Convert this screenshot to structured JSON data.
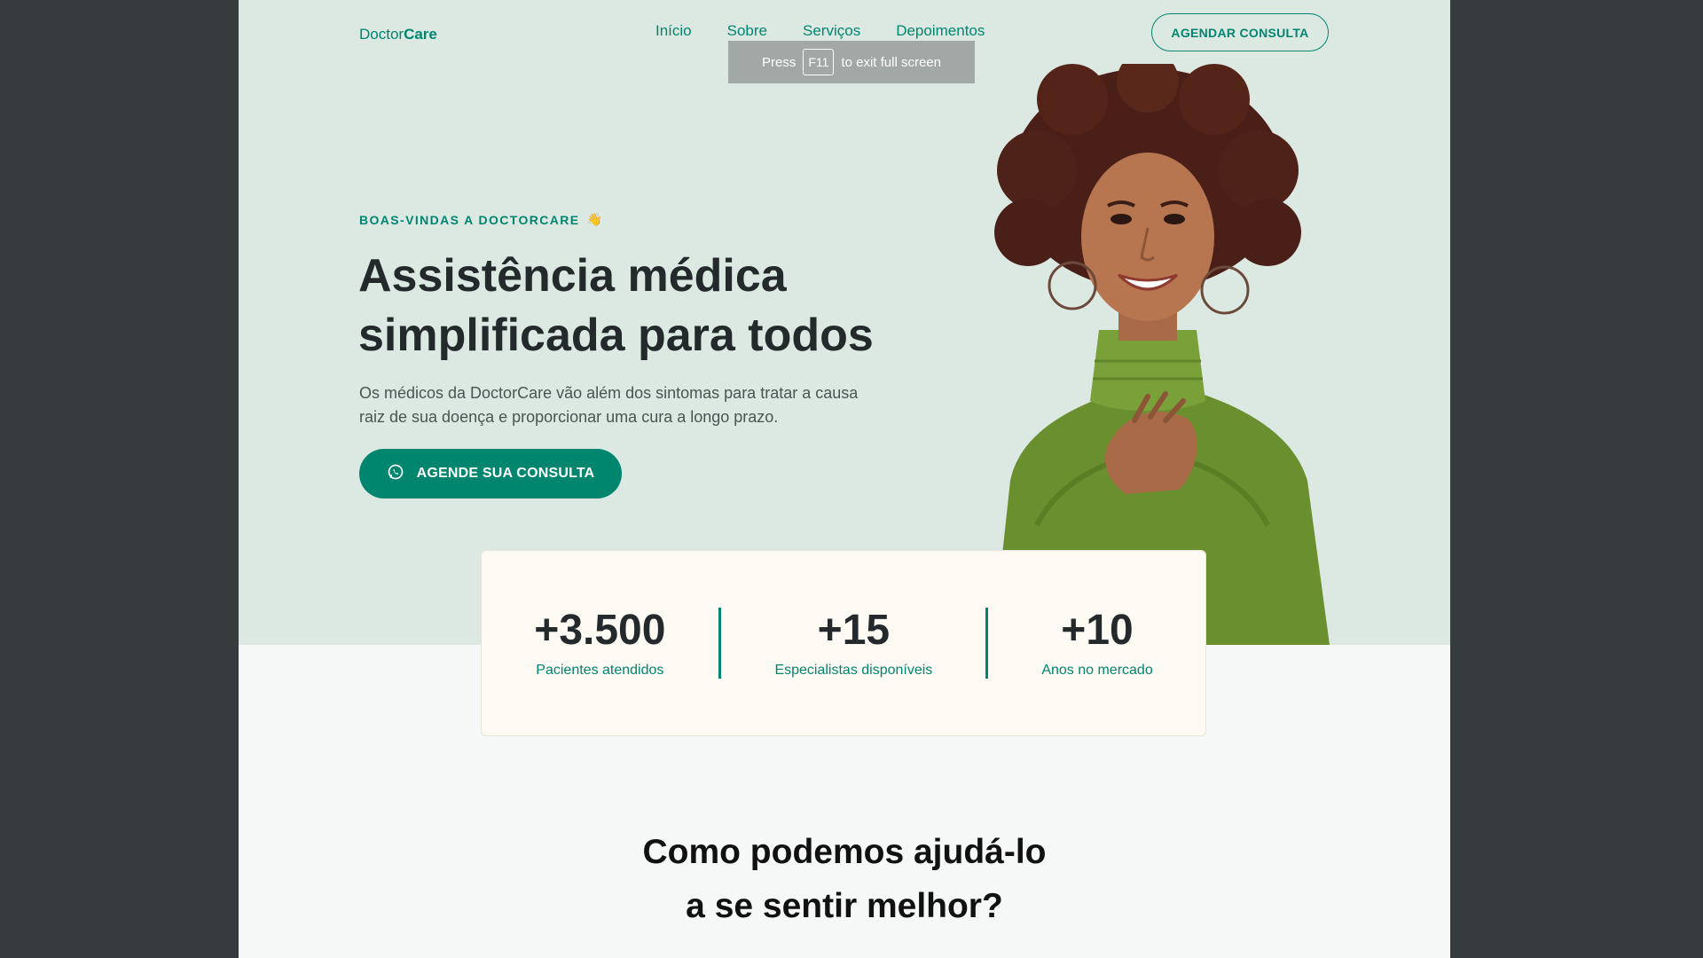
{
  "header": {
    "logo_prefix": "Doctor",
    "logo_suffix": "Care",
    "nav": [
      "Início",
      "Sobre",
      "Serviços",
      "Depoimentos"
    ],
    "cta_label": "AGENDAR CONSULTA"
  },
  "fullscreen_toast": {
    "press": "Press",
    "key": "F11",
    "suffix": "to exit full screen"
  },
  "hero": {
    "eyebrow": "BOAS-VINDAS A DOCTORCARE",
    "eyebrow_emoji": "👋",
    "title_line1": "Assistência médica",
    "title_line2": "simplificada para todos",
    "description": "Os médicos da DoctorCare vão além dos sintomas para tratar a causa raiz de sua doença e proporcionar uma cura a longo prazo.",
    "button_label": "AGENDE SUA CONSULTA",
    "button_icon": "whatsapp-icon"
  },
  "stats": [
    {
      "value": "+3.500",
      "label": "Pacientes atendidos"
    },
    {
      "value": "+15",
      "label": "Especialistas disponíveis"
    },
    {
      "value": "+10",
      "label": "Anos no mercado"
    }
  ],
  "services": {
    "title_line1": "Como podemos ajudá-lo",
    "title_line2": "a se sentir melhor?"
  },
  "colors": {
    "brand": "#00856f",
    "hero_bg": "#dce9e2",
    "stats_bg": "#fdf9f3",
    "outer_bg": "#363b3e"
  }
}
